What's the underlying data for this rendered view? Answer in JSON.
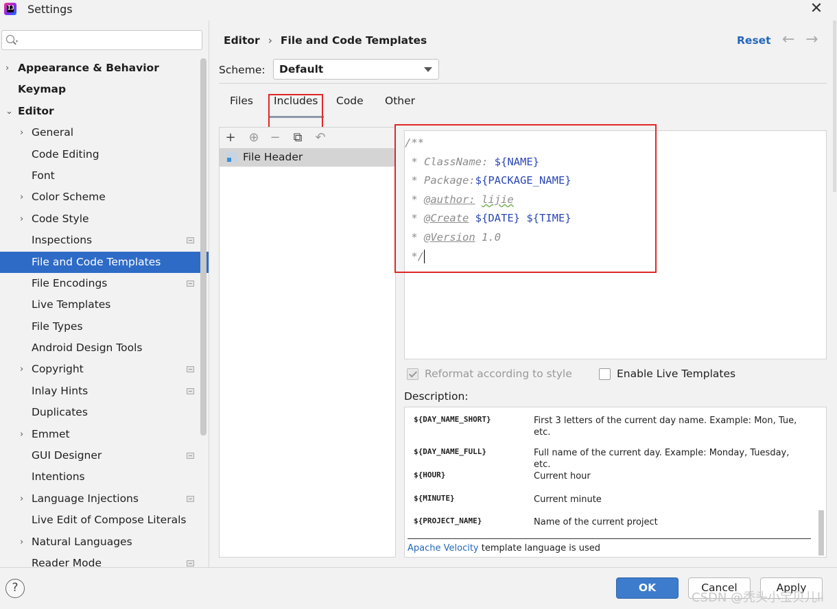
{
  "window": {
    "title": "Settings",
    "close": "✕"
  },
  "sidebar": {
    "search_placeholder": "",
    "items": [
      {
        "label": "Appearance & Behavior",
        "level": 0,
        "arrow": "›",
        "bold": true
      },
      {
        "label": "Keymap",
        "level": 0,
        "arrow": "",
        "bold": true
      },
      {
        "label": "Editor",
        "level": 0,
        "arrow": "⌄",
        "bold": true
      },
      {
        "label": "General",
        "level": 1,
        "arrow": "›"
      },
      {
        "label": "Code Editing",
        "level": 1,
        "arrow": ""
      },
      {
        "label": "Font",
        "level": 1,
        "arrow": ""
      },
      {
        "label": "Color Scheme",
        "level": 1,
        "arrow": "›"
      },
      {
        "label": "Code Style",
        "level": 1,
        "arrow": "›"
      },
      {
        "label": "Inspections",
        "level": 1,
        "arrow": "",
        "mark": true
      },
      {
        "label": "File and Code Templates",
        "level": 1,
        "arrow": "",
        "selected": true
      },
      {
        "label": "File Encodings",
        "level": 1,
        "arrow": "",
        "mark": true
      },
      {
        "label": "Live Templates",
        "level": 1,
        "arrow": ""
      },
      {
        "label": "File Types",
        "level": 1,
        "arrow": ""
      },
      {
        "label": "Android Design Tools",
        "level": 1,
        "arrow": ""
      },
      {
        "label": "Copyright",
        "level": 1,
        "arrow": "›",
        "mark": true
      },
      {
        "label": "Inlay Hints",
        "level": 1,
        "arrow": "",
        "mark": true
      },
      {
        "label": "Duplicates",
        "level": 1,
        "arrow": ""
      },
      {
        "label": "Emmet",
        "level": 1,
        "arrow": "›"
      },
      {
        "label": "GUI Designer",
        "level": 1,
        "arrow": "",
        "mark": true
      },
      {
        "label": "Intentions",
        "level": 1,
        "arrow": ""
      },
      {
        "label": "Language Injections",
        "level": 1,
        "arrow": "›",
        "mark": true
      },
      {
        "label": "Live Edit of Compose Literals",
        "level": 1,
        "arrow": ""
      },
      {
        "label": "Natural Languages",
        "level": 1,
        "arrow": "›"
      },
      {
        "label": "Reader Mode",
        "level": 1,
        "arrow": "",
        "mark": true
      }
    ]
  },
  "header": {
    "breadcrumb_parent": "Editor",
    "breadcrumb_sep": "›",
    "breadcrumb_current": "File and Code Templates",
    "reset": "Reset",
    "back": "←",
    "forward": "→"
  },
  "scheme": {
    "label": "Scheme:",
    "value": "Default"
  },
  "tabs": [
    "Files",
    "Includes",
    "Code",
    "Other"
  ],
  "active_tab": "Includes",
  "toolbar_icons": [
    "+",
    "⊕",
    "−",
    "⧉",
    "↶"
  ],
  "template_list": [
    {
      "name": "File Header"
    }
  ],
  "editor": {
    "lines": [
      [
        {
          "t": "/**",
          "c": "c-comment"
        }
      ],
      [
        {
          "t": " * ClassName: ",
          "c": "c-comment"
        },
        {
          "t": "${NAME}",
          "c": "c-var"
        }
      ],
      [
        {
          "t": " * Package:",
          "c": "c-comment"
        },
        {
          "t": "${PACKAGE_NAME}",
          "c": "c-var"
        }
      ],
      [
        {
          "t": " * ",
          "c": "c-comment"
        },
        {
          "t": "@author:",
          "c": "c-tag"
        },
        {
          "t": " ",
          "c": "c-comment"
        },
        {
          "t": "lijie",
          "c": "c-wavy"
        }
      ],
      [
        {
          "t": " * ",
          "c": "c-comment"
        },
        {
          "t": "@Create",
          "c": "c-tag"
        },
        {
          "t": " ",
          "c": "c-comment"
        },
        {
          "t": "${DATE}",
          "c": "c-var"
        },
        {
          "t": " ",
          "c": "c-comment"
        },
        {
          "t": "${TIME}",
          "c": "c-var"
        }
      ],
      [
        {
          "t": " * ",
          "c": "c-comment"
        },
        {
          "t": "@Version",
          "c": "c-tag"
        },
        {
          "t": " 1.0",
          "c": "c-comment"
        }
      ],
      [
        {
          "t": " */",
          "c": "c-comment"
        }
      ]
    ]
  },
  "options": {
    "reformat_label": "Reformat according to style",
    "reformat_checked": true,
    "live_templates_label": "Enable Live Templates",
    "live_templates_checked": false
  },
  "description": {
    "label": "Description:",
    "rows": [
      {
        "key": "${DAY_NAME_SHORT}",
        "value": "First 3 letters of the current day name. Example: Mon, Tue, etc."
      },
      {
        "key": "${DAY_NAME_FULL}",
        "value": "Full name of the current day. Example: Monday, Tuesday, etc."
      },
      {
        "key": "${HOUR}",
        "value": "Current hour"
      },
      {
        "key": "${MINUTE}",
        "value": "Current minute"
      },
      {
        "key": "${PROJECT_NAME}",
        "value": "Name of the current project"
      }
    ],
    "footer_link": "Apache Velocity",
    "footer_text": " template language is used"
  },
  "footer": {
    "help": "?",
    "ok": "OK",
    "cancel": "Cancel",
    "apply": "Apply"
  },
  "watermark": "CSDN @秃头小宝贝儿li",
  "colors": {
    "selection": "#2e6bc6",
    "accent": "#2467b9",
    "highlight_box": "#e02626",
    "ok_button": "#3d7ccc"
  }
}
